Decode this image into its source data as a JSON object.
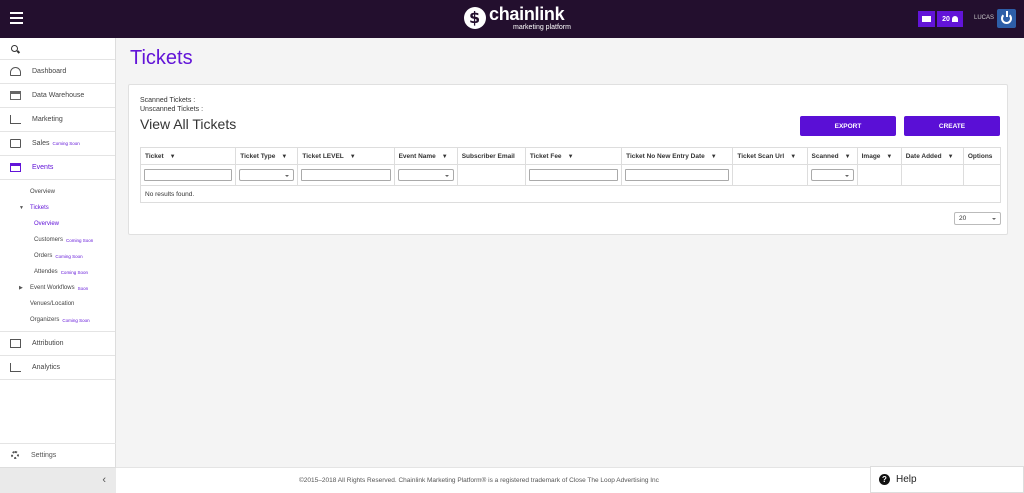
{
  "header": {
    "brand_name": "chainlink",
    "brand_tagline": "marketing platform",
    "notification_count": "20",
    "user": "LUCAS"
  },
  "sidebar": {
    "items": [
      {
        "label": "Dashboard"
      },
      {
        "label": "Data Warehouse"
      },
      {
        "label": "Marketing"
      },
      {
        "label": "Sales",
        "badge": "Coming Soon"
      },
      {
        "label": "Events"
      },
      {
        "label": "Attribution"
      },
      {
        "label": "Analytics"
      }
    ],
    "events_sub": {
      "overview": "Overview",
      "tickets": "Tickets",
      "tickets_overview": "Overview",
      "customers": "Customers",
      "customers_badge": "Coming Soon",
      "orders": "Orders",
      "orders_badge": "Coming Soon",
      "attendes": "Attendes",
      "attendes_badge": "Coming Soon",
      "workflows": "Event Workflows",
      "workflows_badge": "Soon",
      "venues": "Venues/Location",
      "organizers": "Organizers",
      "organizers_badge": "Coming Soon"
    },
    "settings": "Settings"
  },
  "main": {
    "page_title": "Tickets",
    "scanned_label": "Scanned Tickets :",
    "unscanned_label": "Unscanned Tickets :",
    "card_title": "View All Tickets",
    "export_label": "EXPORT",
    "create_label": "CREATE",
    "columns": [
      {
        "label": "Ticket",
        "sortable": true
      },
      {
        "label": "Ticket Type",
        "sortable": true
      },
      {
        "label": "Ticket LEVEL",
        "sortable": true
      },
      {
        "label": "Event Name",
        "sortable": true
      },
      {
        "label": "Subscriber Email",
        "sortable": false
      },
      {
        "label": "Ticket Fee",
        "sortable": true
      },
      {
        "label": "Ticket No New Entry Date",
        "sortable": true
      },
      {
        "label": "Ticket Scan Url",
        "sortable": true
      },
      {
        "label": "Scanned",
        "sortable": true
      },
      {
        "label": "Image",
        "sortable": true
      },
      {
        "label": "Date Added",
        "sortable": true
      },
      {
        "label": "Options",
        "sortable": false
      }
    ],
    "no_results": "No results found.",
    "page_size": "20"
  },
  "footer": {
    "copyright": "©2015–2018 All Rights Reserved. Chainlink Marketing Platform® is a registered trademark of Close The Loop Advertising Inc",
    "help_label": "Help"
  },
  "colors": {
    "header_bg": "#230f2e",
    "accent": "#6214d8",
    "button": "#5a0fd6"
  }
}
